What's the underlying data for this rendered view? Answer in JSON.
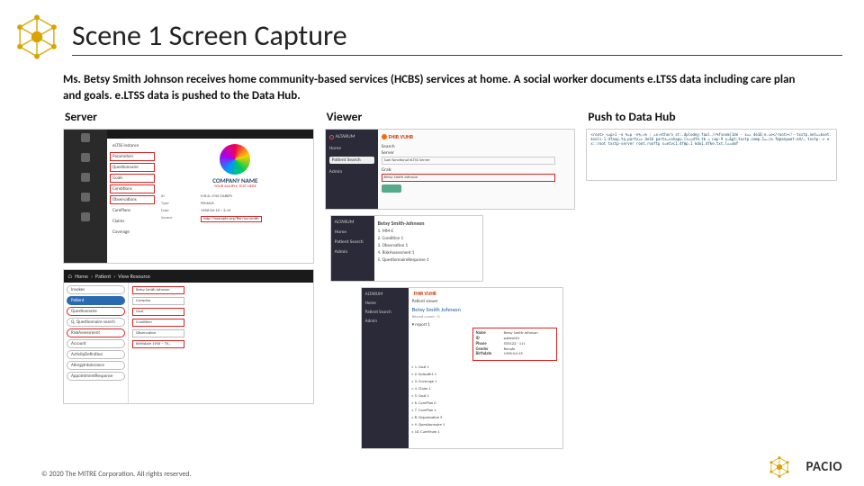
{
  "title": "Scene 1 Screen Capture",
  "description": "Ms. Betsy Smith Johnson receives home community-based services (HCBS) services at home. A social worker documents e.LTSS data including care plan and goals. e.LTSS data is pushed to the Data Hub.",
  "columns": {
    "server": "Server",
    "viewer": "Viewer",
    "push": "Push to Data Hub"
  },
  "server_top": {
    "nav": [
      "eLTSS instance",
      "Parameters",
      "Questionnaire",
      "Goals",
      "Conditions",
      "Observations",
      "CarePlans",
      "Claims",
      "Coverage"
    ],
    "company": "COMPANY NAME",
    "tagline": "YOUR SAMPLE TEXT HERE",
    "rows": [
      {
        "k": "ID",
        "v": "H.R.D. LTSS-CAREPL"
      },
      {
        "k": "Type",
        "v": "FEMALE"
      },
      {
        "k": "Date",
        "v": "1956-04-15 ~ 2.19"
      },
      {
        "k": "Source",
        "v": "http://example.org/fhir/ms-smith"
      }
    ]
  },
  "server_bot": {
    "crumbs": [
      "Home",
      "Patient",
      "View Resource"
    ],
    "nav": [
      "Invokes",
      "Patient",
      "Questionnaire",
      "Q. Questionnaire search",
      "RiskAssessment",
      "Account",
      "ActivityDefinition",
      "AllergyIntolerance",
      "AppointmentResponse"
    ],
    "items": [
      "Betsy Smith Johnson",
      "Careplan",
      "Goal",
      "Condition",
      "Observation",
      "Birthdate 1956 – Th…"
    ]
  },
  "viewer_top": {
    "brand": "ALTARUM",
    "nav": [
      "Home",
      "Patient Search",
      "Admin"
    ],
    "app": "FHIR VUHR",
    "search_hdr": "Search",
    "server_lbl": "Server",
    "server_val": "Sam functional eLTSS Server",
    "grab_lbl": "Grab",
    "grab_val": "Betsy Smith Johnson"
  },
  "viewer_mid": {
    "brand": "ALTARUM",
    "nav": [
      "Home",
      "Patient Search",
      "Admin"
    ],
    "title": "Betsy Smith-Johnson",
    "items": [
      "1. MM-E",
      "2. Condition 1",
      "3. Observation 1",
      "4. RiskAssessment 1",
      "5. QuestionnaireResponse 1"
    ]
  },
  "viewer_bot": {
    "brand": "ALTARUM",
    "nav": [
      "Home",
      "Patient Search",
      "Admin"
    ],
    "app": "FHIR VUHR",
    "sub": "Patient viewer",
    "name": "Betsy Smith Johnson",
    "record": "Record count: ~3",
    "card": [
      {
        "k": "Name",
        "v": "Betsy Smith-Johnson"
      },
      {
        "k": "ID",
        "v": "patient01"
      },
      {
        "k": "Phone",
        "v": "555122 - 111"
      },
      {
        "k": "Gender",
        "v": "female"
      },
      {
        "k": "Birthdate",
        "v": "1956-04-15"
      }
    ],
    "accordion": [
      "1. Goal 1",
      "2. Episode1 1",
      "3. Coverage 1",
      "4. Claim 1",
      "5. Goal 1",
      "6. CarePlan 0",
      "7. CarePlan 1",
      "8. Organization 5",
      "9. Questionnaire 1",
      "10. CareTeam 1"
    ],
    "report": "▾ report 1"
  },
  "push_top": "<root> <=p>1 -e %=p -n%,=% : =x‹ethorn st:.dplodey.faul.//%fsonm[1de - x== 4e16:e.=e</root><!--txstp.net==kset:ksols-1.4faxp.tq.partx== 4e16 partx…sxhapu.[s==dfd.tb = nup-9 x…&gt;txstp.comp.1=…(e.fmpanywet:e4/… txstp--> ex::root txstp-server root.rooftp s=etvc1.4fmp.1 kdo1.4fke.txt.l==xmf",
  "footer": "© 2020 The MITRE Corporation. All rights reserved.",
  "brand": "PACIO"
}
